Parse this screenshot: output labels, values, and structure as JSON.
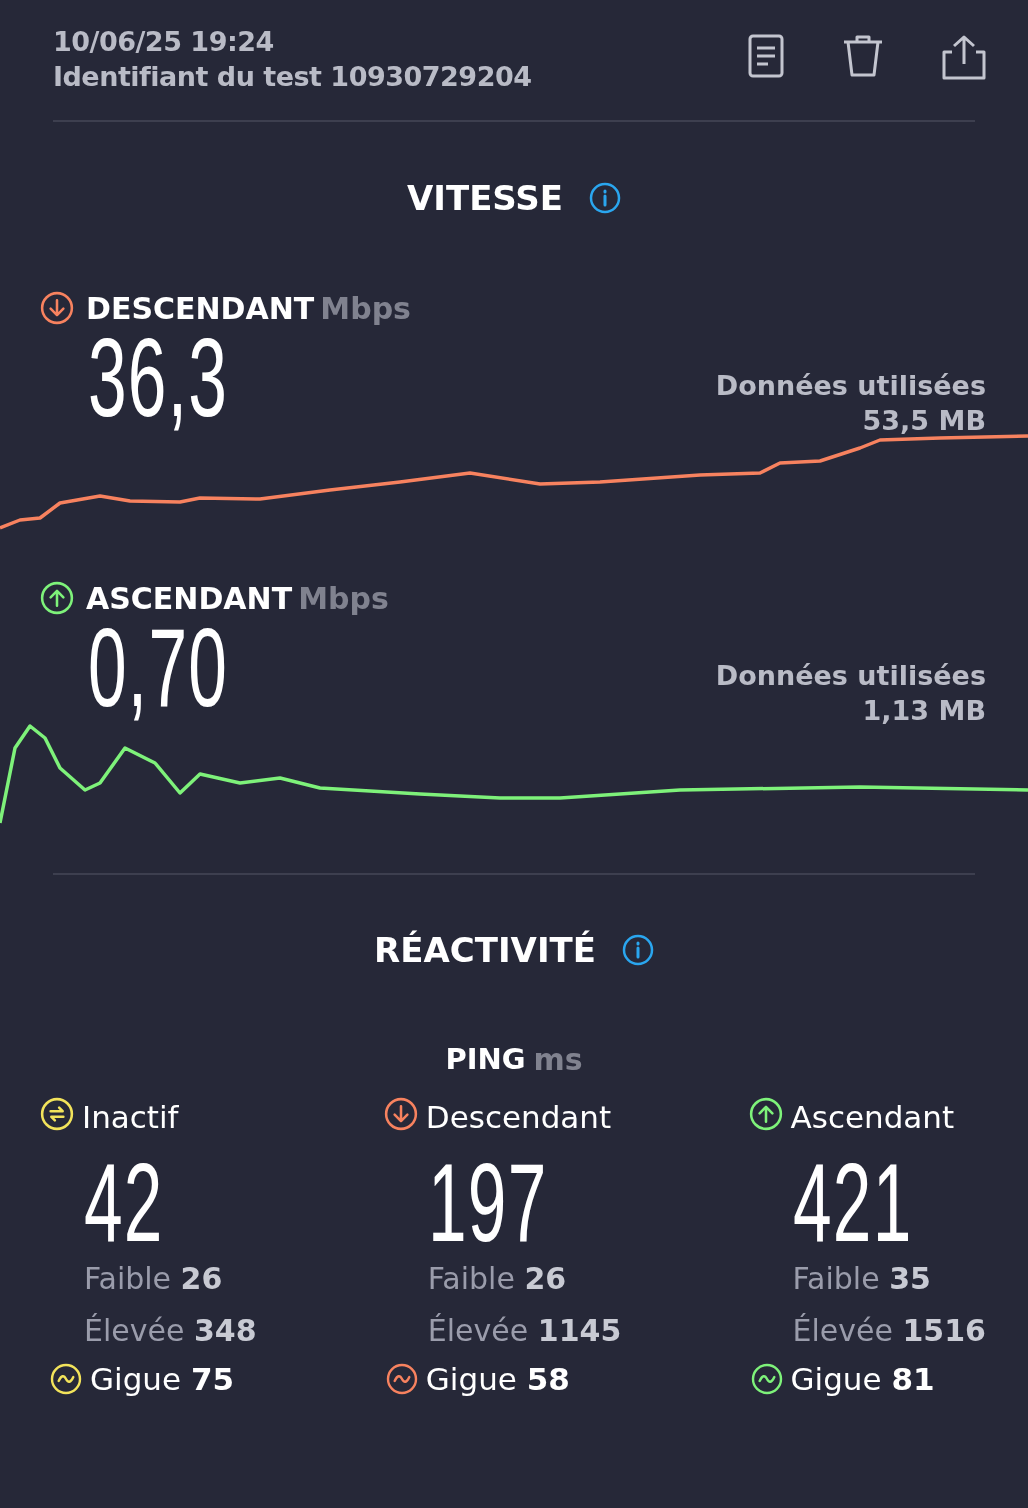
{
  "header": {
    "date": "10/06/25 19:24",
    "test_id": "Identifiant du test 10930729204"
  },
  "speed": {
    "title": "VITESSE",
    "results": [
      {
        "kind": "download",
        "label": "DESCENDANT",
        "unit": "Mbps",
        "value": "36,3",
        "data_label": "Données utilisées",
        "data_value": "53,5 MB",
        "color": "#f7825f"
      },
      {
        "kind": "upload",
        "label": "ASCENDANT",
        "unit": "Mbps",
        "value": "0,70",
        "data_label": "Données utilisées",
        "data_value": "1,13 MB",
        "color": "#7ef27a"
      }
    ]
  },
  "responsiveness": {
    "title": "RÉACTIVITÉ",
    "ping_label": "PING",
    "ping_unit": "ms",
    "columns": [
      {
        "kind": "idle",
        "label": "Inactif",
        "value": "42",
        "low": "Faible **26**",
        "high": "Élevée **348**",
        "jitter": "Gigue **75**",
        "color": "#f2e35b"
      },
      {
        "kind": "download",
        "label": "Descendant",
        "value": "197",
        "low": "Faible **26**",
        "high": "Élevée **1145**",
        "jitter": "Gigue **58**",
        "color": "#f7825f"
      },
      {
        "kind": "upload",
        "label": "Ascendant",
        "value": "421",
        "low": "Faible **35**",
        "high": "Élevée **1516**",
        "jitter": "Gigue **81**",
        "color": "#7ef27a"
      }
    ]
  }
}
